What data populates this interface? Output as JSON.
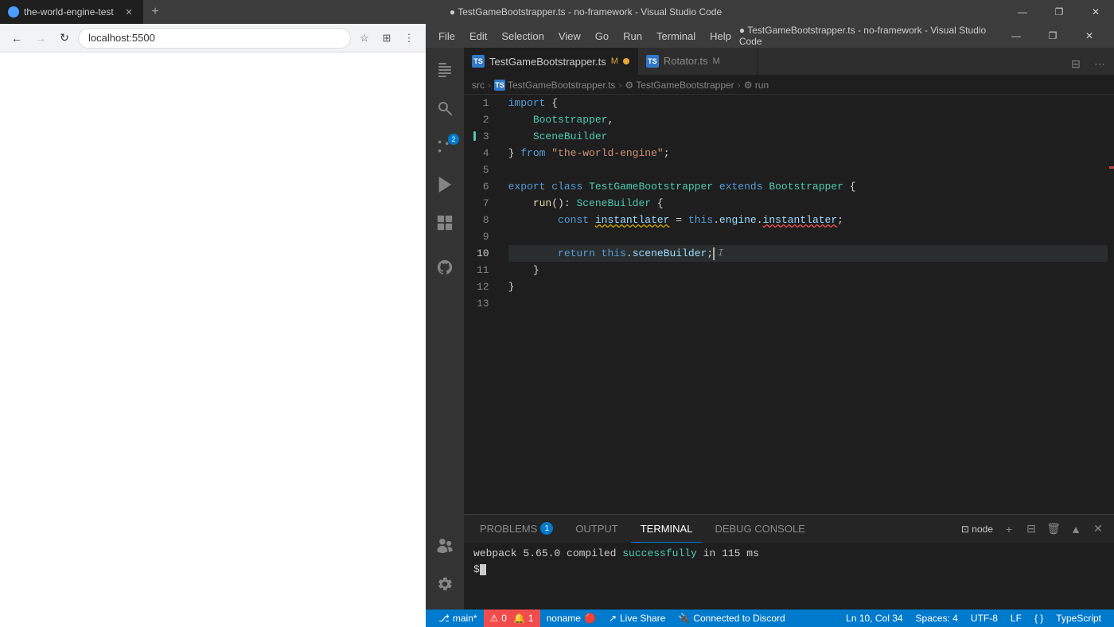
{
  "titlebar": {
    "tab_title": "the-world-engine-test",
    "new_tab_label": "+",
    "title": "● TestGameBootstrapper.ts - no-framework - Visual Studio Code",
    "minimize": "—",
    "maximize": "❐",
    "close": "✕"
  },
  "browser": {
    "url": "localhost:5500",
    "back_btn": "←",
    "forward_btn": "→",
    "refresh_btn": "↻",
    "bookmark_icon": "☆",
    "extensions_icon": "⊞",
    "menu_icon": "⋮"
  },
  "vscode": {
    "menu_items": [
      "File",
      "Edit",
      "Selection",
      "View",
      "Go",
      "Run",
      "Terminal",
      "Help"
    ],
    "title": "● TestGameBootstrapper.ts - no-framework - Visual Studio Code",
    "activity_icons": [
      "files",
      "search",
      "source-control",
      "debug",
      "extensions",
      "github",
      "remote"
    ],
    "tabs": [
      {
        "icon": "TS",
        "label": "TestGameBootstrapper.ts",
        "modified": true,
        "active": true,
        "badge": "M"
      },
      {
        "icon": "TS",
        "label": "Rotator.ts",
        "modified": true,
        "active": false,
        "badge": "M"
      }
    ],
    "breadcrumb": [
      "src",
      ">",
      "TS TestGameBootstrapper.ts",
      ">",
      "⚙ TestGameBootstrapper",
      ">",
      "⚙ run"
    ],
    "code": {
      "lines": [
        {
          "num": 1,
          "tokens": [
            {
              "t": "kw",
              "v": "import"
            },
            {
              "t": "plain",
              "v": " {"
            }
          ]
        },
        {
          "num": 2,
          "tokens": [
            {
              "t": "plain",
              "v": "    "
            },
            {
              "t": "cls",
              "v": "Bootstrapper"
            },
            {
              "t": "plain",
              "v": ","
            }
          ]
        },
        {
          "num": 3,
          "tokens": [
            {
              "t": "plain",
              "v": "    "
            },
            {
              "t": "cls",
              "v": "SceneBuilder"
            }
          ]
        },
        {
          "num": 4,
          "tokens": [
            {
              "t": "plain",
              "v": "} "
            },
            {
              "t": "kw",
              "v": "from"
            },
            {
              "t": "plain",
              "v": " "
            },
            {
              "t": "str",
              "v": "\"the-world-engine\""
            },
            {
              "t": "plain",
              "v": ";"
            }
          ]
        },
        {
          "num": 5,
          "tokens": []
        },
        {
          "num": 6,
          "tokens": [
            {
              "t": "kw",
              "v": "export"
            },
            {
              "t": "plain",
              "v": " "
            },
            {
              "t": "kw",
              "v": "class"
            },
            {
              "t": "plain",
              "v": " "
            },
            {
              "t": "cls",
              "v": "TestGameBootstrapper"
            },
            {
              "t": "plain",
              "v": " "
            },
            {
              "t": "kw",
              "v": "extends"
            },
            {
              "t": "plain",
              "v": " "
            },
            {
              "t": "cls",
              "v": "Bootstrapper"
            },
            {
              "t": "plain",
              "v": " {"
            }
          ]
        },
        {
          "num": 7,
          "tokens": [
            {
              "t": "plain",
              "v": "    "
            },
            {
              "t": "fn",
              "v": "run"
            },
            {
              "t": "plain",
              "v": "(): "
            },
            {
              "t": "cls",
              "v": "SceneBuilder"
            },
            {
              "t": "plain",
              "v": " {"
            }
          ]
        },
        {
          "num": 8,
          "tokens": [
            {
              "t": "plain",
              "v": "        "
            },
            {
              "t": "kw",
              "v": "const"
            },
            {
              "t": "plain",
              "v": " "
            },
            {
              "t": "var",
              "v": "instantlater"
            },
            {
              "t": "plain",
              "v": " = "
            },
            {
              "t": "kw",
              "v": "this"
            },
            {
              "t": "plain",
              "v": "."
            },
            {
              "t": "prop",
              "v": "engine"
            },
            {
              "t": "plain",
              "v": "."
            },
            {
              "t": "prop",
              "v": "instantlater"
            },
            {
              "t": "plain",
              "v": ";"
            }
          ]
        },
        {
          "num": 9,
          "tokens": []
        },
        {
          "num": 10,
          "tokens": [
            {
              "t": "plain",
              "v": "        "
            },
            {
              "t": "kw",
              "v": "return"
            },
            {
              "t": "plain",
              "v": " "
            },
            {
              "t": "kw",
              "v": "this"
            },
            {
              "t": "plain",
              "v": "."
            },
            {
              "t": "prop",
              "v": "sceneBuilder"
            },
            {
              "t": "plain",
              "v": ";"
            },
            {
              "t": "cursor",
              "v": ""
            }
          ],
          "current": true
        },
        {
          "num": 11,
          "tokens": [
            {
              "t": "plain",
              "v": "    }"
            }
          ]
        },
        {
          "num": 12,
          "tokens": [
            {
              "t": "plain",
              "v": "}"
            }
          ]
        },
        {
          "num": 13,
          "tokens": []
        }
      ]
    },
    "terminal": {
      "tabs": [
        {
          "label": "PROBLEMS",
          "active": false,
          "badge": "1"
        },
        {
          "label": "OUTPUT",
          "active": false,
          "badge": null
        },
        {
          "label": "TERMINAL",
          "active": true,
          "badge": null
        },
        {
          "label": "DEBUG CONSOLE",
          "active": false,
          "badge": null
        }
      ],
      "node_label": "node",
      "content": "webpack 5.65.0 compiled successfully in 115 ms",
      "success_word": "successfully",
      "prompt": "$"
    },
    "statusbar": {
      "left": [
        {
          "icon": "⚡",
          "label": "main*"
        },
        {
          "icon": "",
          "label": "⚠ 0  🔔 1"
        },
        {
          "icon": "",
          "label": "noname 🔴"
        },
        {
          "icon": "🔗",
          "label": "Live Share"
        },
        {
          "icon": "🔌",
          "label": "Connected to Discord"
        }
      ],
      "right": [
        {
          "label": "Ln 10, Col 34"
        },
        {
          "label": "Spaces: 4"
        },
        {
          "label": "UTF-8"
        },
        {
          "label": "LF"
        },
        {
          "label": "{ }"
        },
        {
          "label": "TypeScript"
        }
      ]
    }
  }
}
